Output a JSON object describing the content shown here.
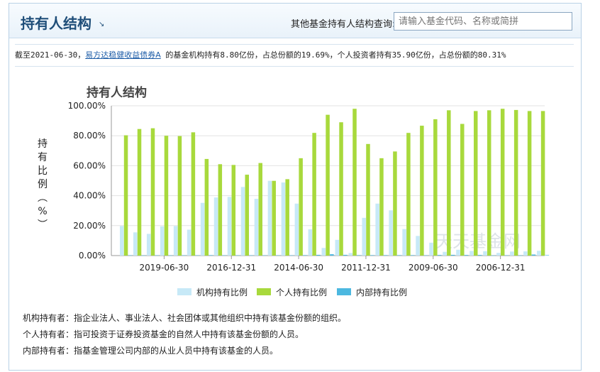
{
  "header": {
    "title": "持有人结构",
    "corner_icon": "↘",
    "search_label": "其他基金持有人结构查询:",
    "search_placeholder": "请输入基金代码、名称或简拼"
  },
  "summary": {
    "prefix": "截至2021-06-30，",
    "fund_link": "易方达稳健收益债券A",
    "suffix": " 的基金机构持有8.80亿份，占总份额的19.69%，个人投资者持有35.90亿份，占总份额的80.31%"
  },
  "watermark": "天天基金网",
  "notes": [
    "机构持有者：指企业法人、事业法人、社会团体或其他组织中持有该基金份额的组织。",
    "个人持有者：指可投资于证券投资基金的自然人中持有该基金份额的人员。",
    "内部持有者：指基金管理公司内部的从业人员中持有该基金的人员。"
  ],
  "chart_data": {
    "type": "bar",
    "title": "持有人结构",
    "ylabel": "持有比例（%）",
    "ylim": [
      0,
      100
    ],
    "y_ticks": [
      "100.00%",
      "80.00%",
      "60.00%",
      "40.00%",
      "20.00%",
      "0.00%"
    ],
    "x_tick_labels": [
      {
        "label": "2019-06-30",
        "index": 3
      },
      {
        "label": "2016-12-31",
        "index": 8
      },
      {
        "label": "2014-06-30",
        "index": 13
      },
      {
        "label": "2011-12-31",
        "index": 18
      },
      {
        "label": "2009-06-30",
        "index": 23
      },
      {
        "label": "2006-12-31",
        "index": 28
      }
    ],
    "series": [
      {
        "name": "机构持有比例",
        "color": "#c7e9f7",
        "values": [
          19.7,
          15.5,
          14.5,
          19.5,
          19.7,
          17.3,
          35.2,
          38.8,
          39.2,
          45.8,
          37.9,
          49.9,
          48.8,
          34.7,
          17.5,
          5.1,
          10.5,
          1.7,
          25.2,
          34.7,
          30.2,
          17.7,
          13.1,
          8.6,
          2.5,
          3.9,
          3.1,
          2.9,
          1.8,
          2.7,
          2.8,
          3.2
        ]
      },
      {
        "name": "个人持有比例",
        "color": "#a8d93c",
        "values": [
          80.3,
          84.5,
          85.0,
          80.0,
          79.8,
          82.3,
          64.5,
          61.0,
          60.5,
          54.0,
          61.8,
          49.9,
          51.0,
          65.0,
          81.9,
          94.0,
          89.0,
          98.0,
          74.5,
          65.0,
          69.5,
          81.9,
          86.7,
          91.0,
          97.0,
          87.9,
          96.5,
          97.0,
          98.0,
          97.2,
          96.5,
          96.5
        ]
      },
      {
        "name": "内部持有比例",
        "color": "#4cb8e0",
        "values": [
          0.2,
          0.1,
          0.2,
          0.1,
          0.2,
          0.2,
          0.3,
          0.2,
          0.2,
          0.2,
          0.2,
          0.2,
          0.2,
          0.3,
          0.5,
          0.9,
          0.5,
          0.3,
          0.3,
          0.3,
          0.3,
          0.3,
          0.2,
          0.4,
          0.5,
          0.4,
          0.4,
          0.1,
          0.2,
          0.1,
          0.7,
          0.3
        ]
      }
    ],
    "legend_position": "bottom",
    "grid": true
  }
}
